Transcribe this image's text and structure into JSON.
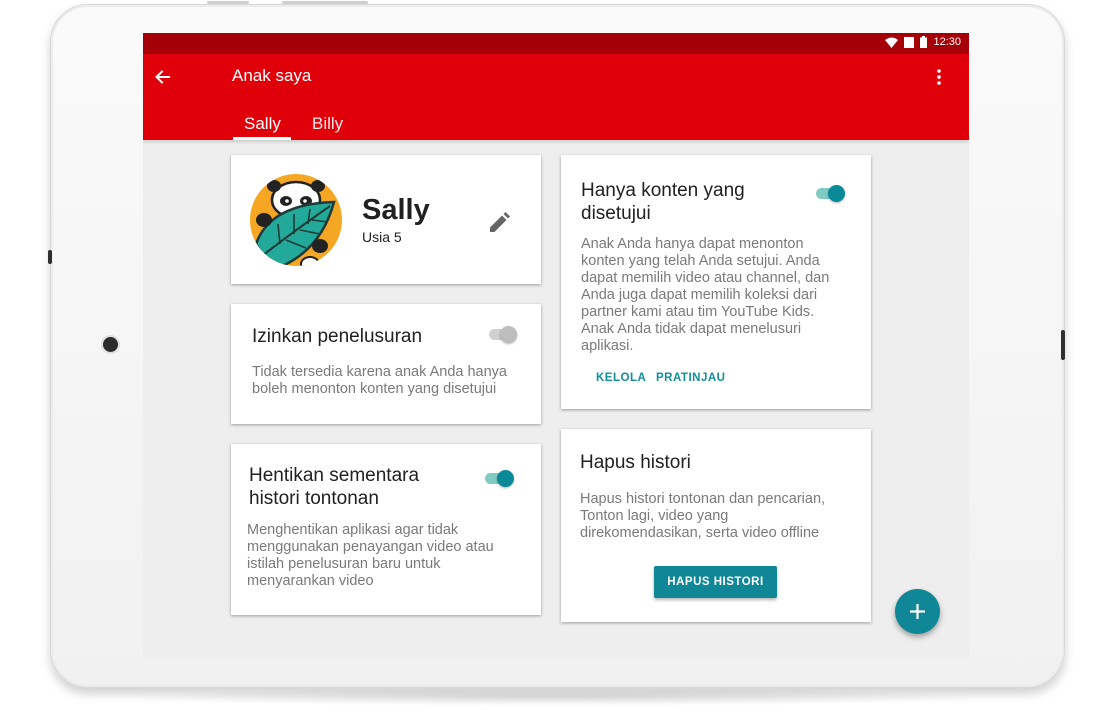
{
  "status_bar": {
    "time": "12:30",
    "icons": [
      "wifi-icon",
      "signal-icon",
      "battery-icon"
    ]
  },
  "app_bar": {
    "title": "Anak saya",
    "back_icon": "arrow-left-icon",
    "menu_icon": "more-vert-icon"
  },
  "tabs": [
    {
      "label": "Sally",
      "selected": true
    },
    {
      "label": "Billy",
      "selected": false
    }
  ],
  "profile": {
    "name": "Sally",
    "age": "Usia 5",
    "avatar": "panda-leaf-avatar",
    "edit_icon": "pencil-icon"
  },
  "cards": {
    "search": {
      "title": "Izinkan penelusuran",
      "body": "Tidak tersedia karena anak Anda hanya boleh menonton konten yang disetujui",
      "toggle_on": false
    },
    "pause_history": {
      "title_line1": "Hentikan sementara",
      "title_line2": "histori tontonan",
      "body": "Menghentikan aplikasi agar tidak menggunakan penayangan video atau istilah penelusuran baru untuk menyarankan video",
      "toggle_on": true
    },
    "approved_content": {
      "title_line1": "Hanya konten yang",
      "title_line2": "disetujui",
      "body": "Anak Anda hanya dapat menonton konten yang telah Anda setujui. Anda dapat memilih video atau channel, dan Anda juga dapat memilih koleksi dari partner kami atau tim YouTube Kids. Anak Anda tidak dapat menelusuri aplikasi.",
      "toggle_on": true,
      "action_manage": "KELOLA",
      "action_preview": "PRATINJAU"
    },
    "clear_history": {
      "title": "Hapus histori",
      "body": "Hapus histori tontonan dan pencarian, Tonton lagi, video yang direkomendasikan, serta video offline",
      "button": "HAPUS HISTORI"
    }
  },
  "fab": {
    "icon": "plus-icon"
  },
  "colors": {
    "app_bar": "#e00009",
    "status_bar": "#a50008",
    "accent": "#0f8796",
    "toggle_track_on": "#80cbc4",
    "background": "#eeeeee"
  }
}
